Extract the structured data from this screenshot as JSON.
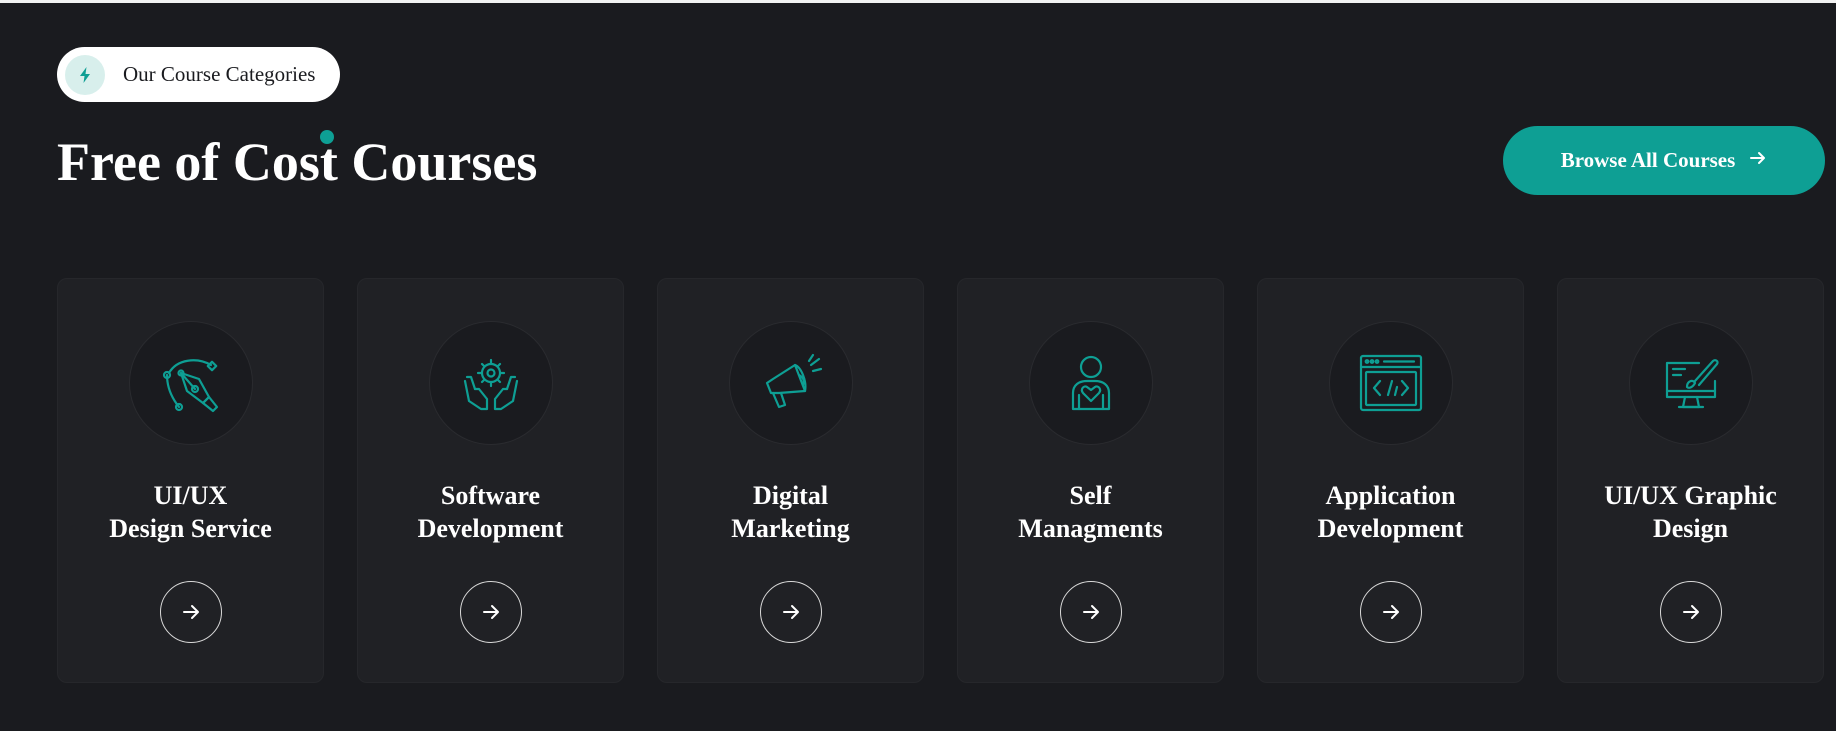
{
  "section": {
    "pill_label": "Our Course Categories",
    "pill_icon": "lightning-bolt-icon",
    "title": "Free of Cost Courses",
    "browse_button": "Browse All Courses"
  },
  "colors": {
    "background": "#1a1b1f",
    "card": "#202125",
    "accent": "#0e9f94",
    "text": "#ffffff"
  },
  "cards": [
    {
      "line1": "UI/UX",
      "line2": "Design Service",
      "icon": "pen-tool-icon"
    },
    {
      "line1": "Software",
      "line2": "Development",
      "icon": "hands-gear-icon"
    },
    {
      "line1": "Digital",
      "line2": "Marketing",
      "icon": "megaphone-icon"
    },
    {
      "line1": "Self",
      "line2": "Managments",
      "icon": "person-heart-icon"
    },
    {
      "line1": "Application",
      "line2": "Development",
      "icon": "code-window-icon"
    },
    {
      "line1": "UI/UX Graphic",
      "line2": "Design",
      "icon": "monitor-brush-icon"
    }
  ]
}
